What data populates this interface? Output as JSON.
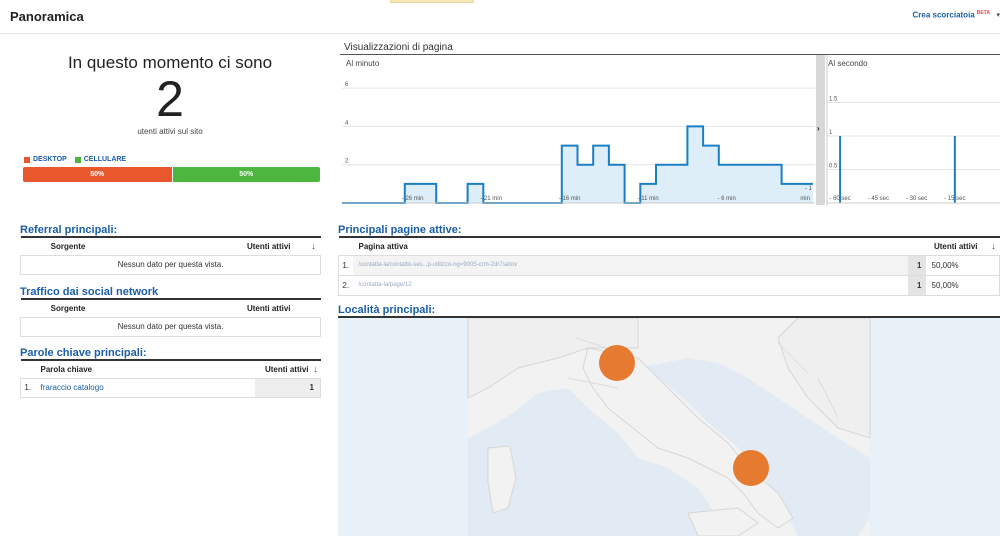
{
  "header": {
    "title": "Panoramica",
    "shortcut_label": "Crea scorciatoia",
    "shortcut_badge": "BETA"
  },
  "now": {
    "title": "In questo momento ci sono",
    "count": "2",
    "subtitle": "utenti attivi sul sito",
    "legend": [
      {
        "label": "DESKTOP",
        "color": "#e8582c"
      },
      {
        "label": "CELLULARE",
        "color": "#4cb63f"
      }
    ],
    "split": [
      {
        "label": "50%",
        "value": 50,
        "color": "#e8582c"
      },
      {
        "label": "50%",
        "value": 50,
        "color": "#4cb63f"
      }
    ]
  },
  "referral": {
    "title": "Referral principali:",
    "col_source": "Sorgente",
    "col_users": "Utenti attivi",
    "empty": "Nessun dato per questa vista."
  },
  "social": {
    "title": "Traffico dai social network",
    "col_source": "Sorgente",
    "col_users": "Utenti attivi",
    "empty": "Nessun dato per questa vista."
  },
  "keywords": {
    "title": "Parole chiave principali:",
    "col_keyword": "Parola chiave",
    "col_users": "Utenti attivi",
    "rows": [
      {
        "idx": "1.",
        "keyword": "fraraccio catalogo",
        "users": "1"
      }
    ]
  },
  "pages": {
    "title": "Principali pagine attive:",
    "col_page": "Pagina attiva",
    "col_users": "Utenti attivi",
    "rows": [
      {
        "idx": "1.",
        "page": "/contatta-la/contatto-ses...p-utilizzo-ng=9005-crm-2dr7setov",
        "users": "1",
        "pct": "50,00%"
      },
      {
        "idx": "2.",
        "page": "/contatta-la/page/12",
        "users": "1",
        "pct": "50,00%"
      }
    ]
  },
  "locations": {
    "title": "Località principali:"
  },
  "chart": {
    "title": "Visualizzazioni di pagina",
    "per_minute_label": "Al minuto",
    "per_second_label": "Al secondo",
    "handle_glyph": "›",
    "minute_yticks": [
      "6",
      "4",
      "2"
    ],
    "minute_xticks": [
      "- 26 min",
      "- 21 min",
      "- 16 min",
      "- 11 min",
      "- 6 min",
      "min"
    ],
    "minute_end_label": "- 1",
    "second_yticks": [
      "1.5",
      "1",
      "0.5"
    ],
    "second_xticks": [
      "- 60 sec",
      "- 45 sec",
      "- 30 sec",
      "- 15 sec"
    ],
    "bar_color": "#1a7fc4"
  },
  "chart_data": [
    {
      "type": "area",
      "title": "Al minuto",
      "x": [
        -30,
        -29,
        -28,
        -27,
        -26,
        -25,
        -24,
        -23,
        -22,
        -21,
        -20,
        -19,
        -18,
        -17,
        -16,
        -15,
        -14,
        -13,
        -12,
        -11,
        -10,
        -9,
        -8,
        -7,
        -6,
        -5,
        -4,
        -3,
        -2,
        -1
      ],
      "values": [
        0,
        0,
        0,
        0,
        1,
        1,
        0,
        0,
        1,
        0,
        0,
        0,
        0,
        0,
        3,
        2,
        3,
        2,
        0,
        1,
        2,
        2,
        4,
        3,
        2,
        2,
        2,
        2,
        1,
        1
      ],
      "ylim": [
        0,
        7
      ]
    },
    {
      "type": "bar",
      "title": "Al secondo",
      "x": [
        -60,
        -15
      ],
      "values": [
        1,
        1
      ],
      "ylim": [
        0,
        2
      ]
    }
  ]
}
